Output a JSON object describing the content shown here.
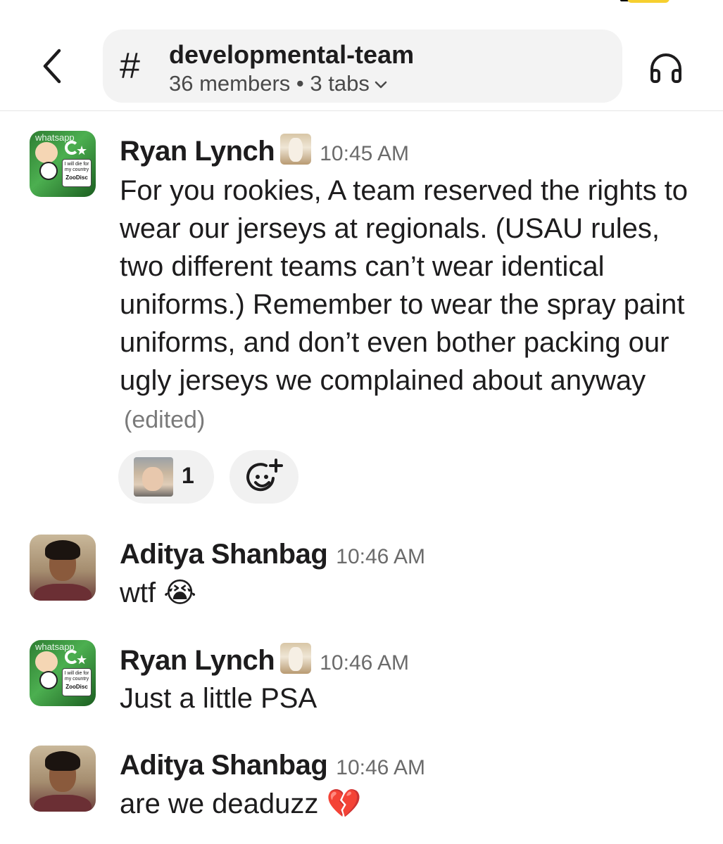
{
  "header": {
    "hash": "#",
    "channel_name": "developmental-team",
    "channel_meta": "36 members • 3 tabs",
    "back_icon": "chevron-left-icon",
    "call_icon": "headphones-icon"
  },
  "messages": [
    {
      "author": "Ryan Lynch",
      "time": "10:45 AM",
      "text": "For you rookies, A team reserved the rights to wear our jerseys at regionals. (USAU rules, two different teams can’t wear identical uniforms.) Remember to wear the spray paint uniforms, and don’t even bother packing our ugly jerseys we complained about anyway",
      "edited": "(edited)",
      "avatar_text": {
        "top": "whatsapp",
        "card": "I will die for my country",
        "brand": "ZooDisc"
      },
      "reactions": [
        {
          "icon": "user-photo-reaction",
          "count": "1"
        }
      ],
      "add_reaction_icon": "add-emoji-icon"
    },
    {
      "author": "Aditya Shanbag",
      "time": "10:46 AM",
      "text": "wtf 😭"
    },
    {
      "author": "Ryan Lynch",
      "time": "10:46 AM",
      "text": "Just a little PSA",
      "avatar_text": {
        "top": "whatsapp",
        "card": "I will die for my country",
        "brand": "ZooDisc"
      }
    },
    {
      "author": "Aditya Shanbag",
      "time": "10:46 AM",
      "text": "are we deaduzz 💔"
    }
  ],
  "colors": {
    "text": "#1d1c1d",
    "muted": "#6b6b6b",
    "pill": "#f3f3f3",
    "battery": "#f6cf2f"
  }
}
